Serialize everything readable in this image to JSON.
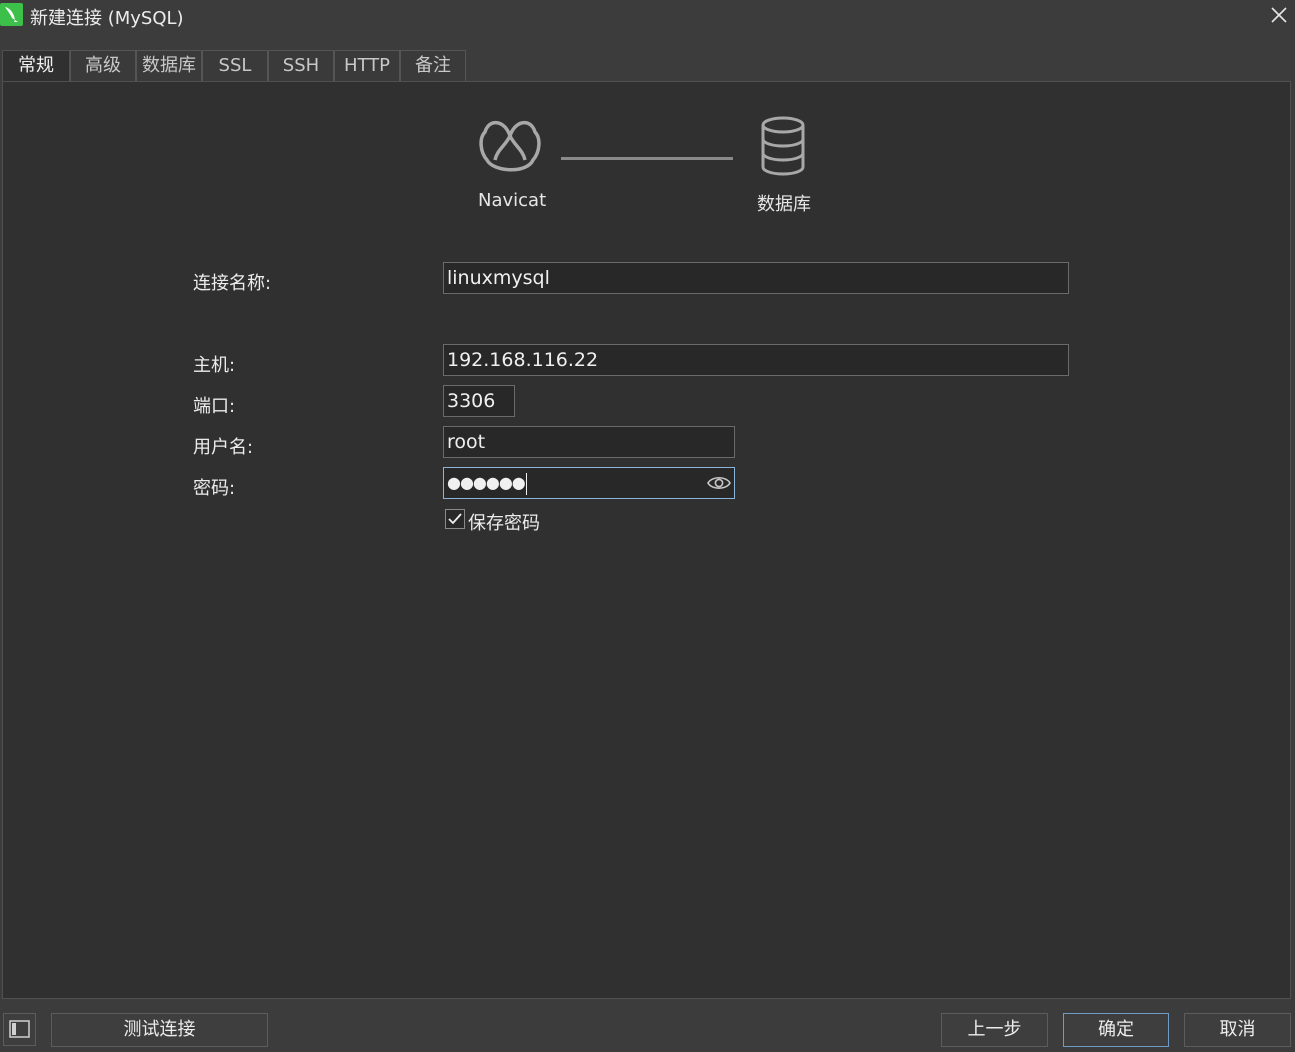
{
  "window": {
    "title": "新建连接 (MySQL)",
    "app_icon": "navicat-dolphin-icon",
    "accent_color": "#3cc04a"
  },
  "tabs": [
    {
      "label": "常规",
      "active": true
    },
    {
      "label": "高级",
      "active": false
    },
    {
      "label": "数据库",
      "active": false
    },
    {
      "label": "SSL",
      "active": false
    },
    {
      "label": "SSH",
      "active": false
    },
    {
      "label": "HTTP",
      "active": false
    },
    {
      "label": "备注",
      "active": false
    }
  ],
  "diagram": {
    "left_label": "Navicat",
    "right_label": "数据库",
    "left_icon": "navicat-logo-icon",
    "right_icon": "database-icon"
  },
  "form": {
    "connection_name": {
      "label": "连接名称:",
      "value": "linuxmysql"
    },
    "host": {
      "label": "主机:",
      "value": "192.168.116.22"
    },
    "port": {
      "label": "端口:",
      "value": "3306"
    },
    "username": {
      "label": "用户名:",
      "value": "root"
    },
    "password": {
      "label": "密码:",
      "value": "●●●●●●"
    },
    "save_password": {
      "label": "保存密码",
      "checked": true
    }
  },
  "buttons": {
    "test_connection": "测试连接",
    "previous": "上一步",
    "ok": "确定",
    "cancel": "取消"
  }
}
